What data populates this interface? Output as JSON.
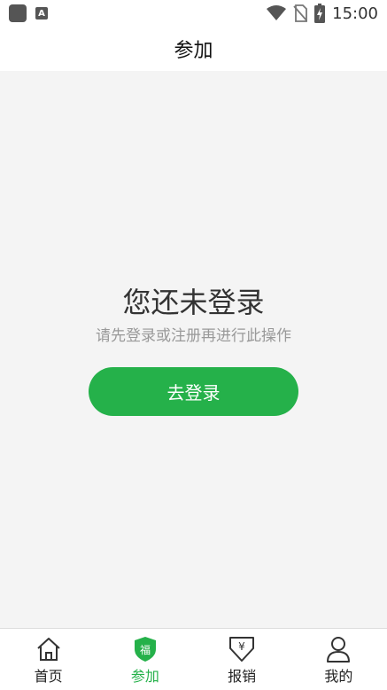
{
  "status_bar": {
    "time": "15:00",
    "a_badge": "A",
    "icons": [
      "app-square-icon",
      "a-badge-icon",
      "wifi-icon",
      "no-sim-icon",
      "battery-charging-icon"
    ]
  },
  "header": {
    "title": "参加"
  },
  "empty_state": {
    "title": "您还未登录",
    "subtitle": "请先登录或注册再进行此操作",
    "button_label": "去登录"
  },
  "tabbar": {
    "items": [
      {
        "label": "首页",
        "icon": "home-icon"
      },
      {
        "label": "参加",
        "icon": "shield-fu-icon",
        "badge_text": "福"
      },
      {
        "label": "报销",
        "icon": "yen-download-icon",
        "badge_text": "¥"
      },
      {
        "label": "我的",
        "icon": "person-icon"
      }
    ],
    "active_color": "#25b14a"
  },
  "colors": {
    "accent": "#25b14a",
    "background": "#f4f4f4"
  }
}
